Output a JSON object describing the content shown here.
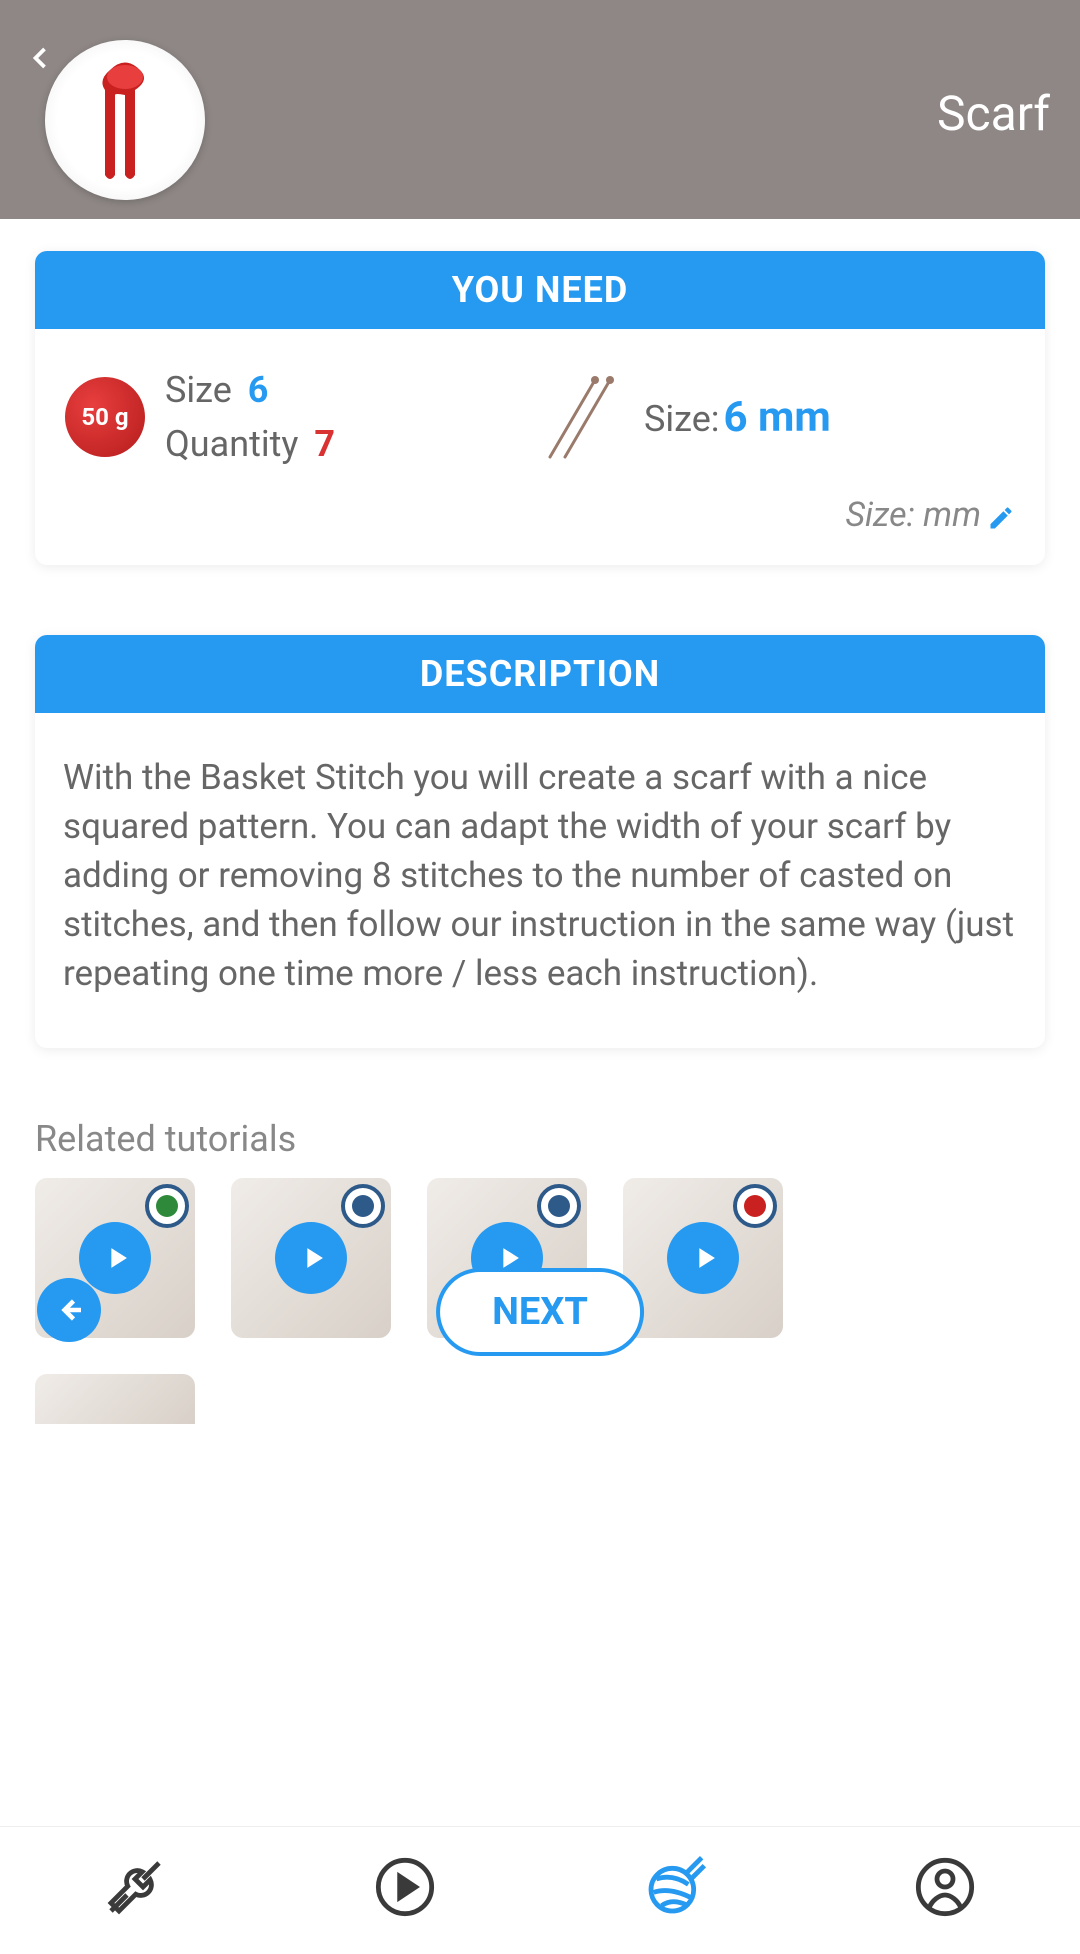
{
  "header": {
    "title": "Scarf"
  },
  "youNeed": {
    "header": "YOU NEED",
    "yarnWeight": "50 g",
    "sizeLabel": "Size",
    "sizeValue": "6",
    "quantityLabel": "Quantity",
    "quantityValue": "7",
    "needleSizeLabel": "Size:",
    "needleSizeValue": "6 mm",
    "editLabel": "Size: mm"
  },
  "description": {
    "header": "DESCRIPTION",
    "body": "With the Basket Stitch you will create a scarf with a nice squared pattern. You can adapt the width of your scarf by adding or removing 8 stitches to the number of casted on stitches, and then follow our instruction in the same way (just repeating one time more / less each instruction)."
  },
  "related": {
    "title": "Related tutorials"
  },
  "nextButton": "NEXT",
  "colors": {
    "accent": "#2699f1",
    "red": "#d83232"
  }
}
